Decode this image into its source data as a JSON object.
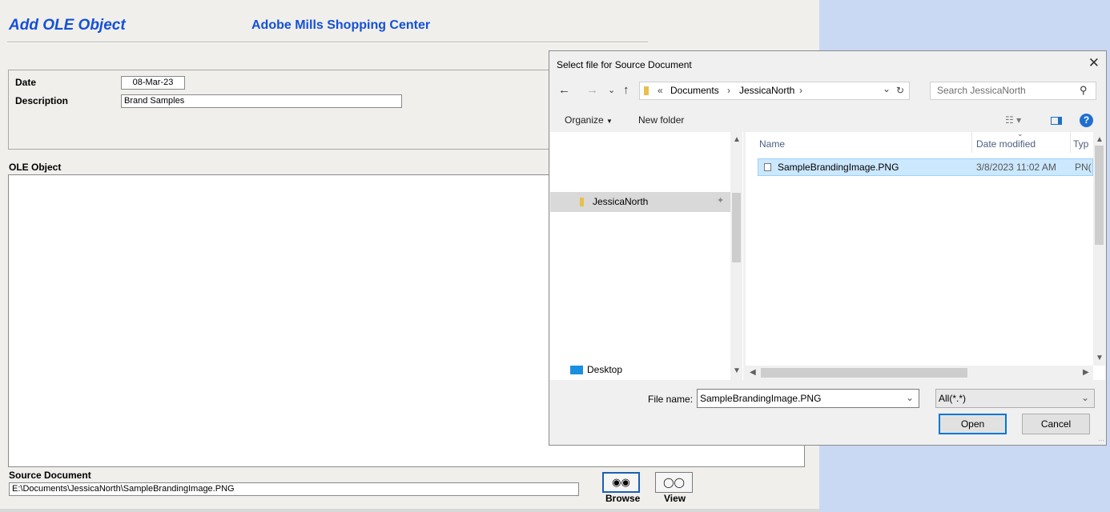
{
  "app": {
    "title": "Add OLE Object",
    "subtitle": "Adobe Mills Shopping Center",
    "date_label": "Date",
    "date_value": "08-Mar-23",
    "description_label": "Description",
    "description_value": "Brand Samples",
    "ole_label": "OLE Object",
    "source_label": "Source Document",
    "source_value": "E:\\Documents\\JessicaNorth\\SampleBrandingImage.PNG",
    "browse_label": "Browse",
    "view_label": "View"
  },
  "dialog": {
    "title": "Select file for Source Document",
    "breadcrumb": [
      "Documents",
      "JessicaNorth"
    ],
    "search_placeholder": "Search JessicaNorth",
    "organize_label": "Organize",
    "new_folder_label": "New folder",
    "nav_items": [
      "JessicaNorth",
      "Desktop"
    ],
    "columns": [
      "Name",
      "Date modified",
      "Typ"
    ],
    "files": [
      {
        "name": "SampleBrandingImage.PNG",
        "date": "3/8/2023 11:02 AM",
        "type": "PN("
      }
    ],
    "file_name_label": "File name:",
    "file_name_value": "SampleBrandingImage.PNG",
    "filter_value": "All(*.*)",
    "open_label": "Open",
    "cancel_label": "Cancel"
  },
  "colors": {
    "accent": "#1450d8",
    "selection": "#cce8ff",
    "desktop_bg": "#c9d9f3"
  }
}
